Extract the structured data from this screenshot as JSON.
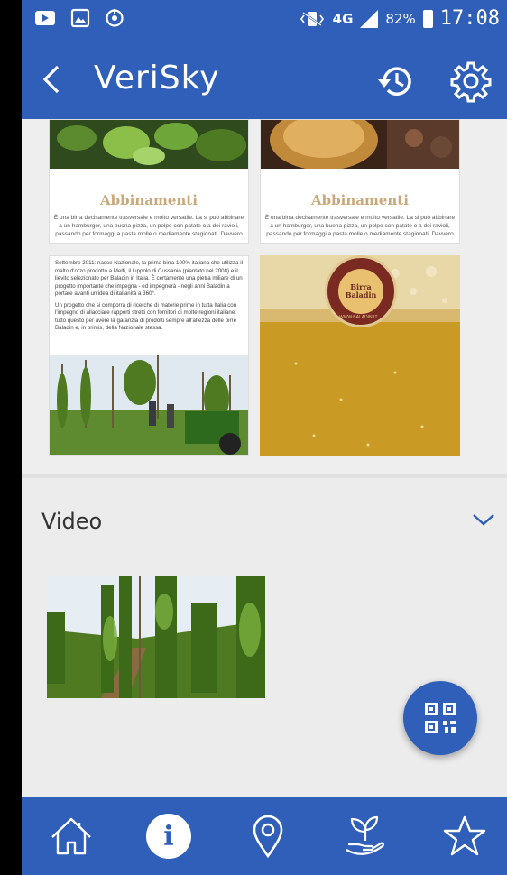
{
  "status_bar": {
    "network": "4G",
    "battery": "82%",
    "time": "17:08"
  },
  "app_bar": {
    "title": "VeriSky"
  },
  "gallery": {
    "tiles": [
      {
        "title": "Abbinamenti",
        "text": "È una birra decisamente trasversale e molto versatile. La si può abbinare a un hamburger, una buona pizza, un polpo con patate o a dei ravioli, passando per formaggi a pasta molle o mediamente stagionati. Davvero"
      },
      {
        "title": "Abbinamenti",
        "text": "È una birra decisamente trasversale e molto versatile. La si può abbinare a un hamburger, una buona pizza, un polpo con patate o a dei ravioli, passando per formaggi a pasta molle o mediamente stagionati. Davvero"
      },
      {
        "paragraph1": "Settembre 2011: nasce Nazionale, la prima birra 100% italiana che utilizza il malto d'orzo prodotto a Melfi, il luppolo di Cussanio (piantato nel 2008) e il lievito selezionato per Baladin in Italia. È certamente una pietra miliare di un progetto importante che impegna - ed impegnerà - negli anni Baladin a portare avanti un'idea di italianità a 360°.",
        "paragraph2": "Un progetto che si comporrà di ricerche di materie prime in tutta Italia con l'impegno di allacciare rapporti stretti con fornitori di molte regioni italiane: tutto questo per avere la garanzia di prodotti sempre all'altezza delle birre Baladin e, in primis, della Nazionale stessa."
      },
      {
        "logo_text": "Birra Baladin",
        "logo_ring_text": "WWW.BALADIN.IT"
      }
    ]
  },
  "video_section": {
    "title": "Video"
  },
  "colors": {
    "primary": "#2f5fb8",
    "background": "#ececec",
    "accent_gold": "#c9a87a"
  },
  "icons": {
    "back": "chevron-left-icon",
    "history": "history-icon",
    "settings": "gear-icon",
    "expand": "chevron-down-icon",
    "qr": "qr-code-icon",
    "nav": [
      "home-icon",
      "info-icon",
      "location-pin-icon",
      "plant-hand-icon",
      "star-icon"
    ]
  }
}
